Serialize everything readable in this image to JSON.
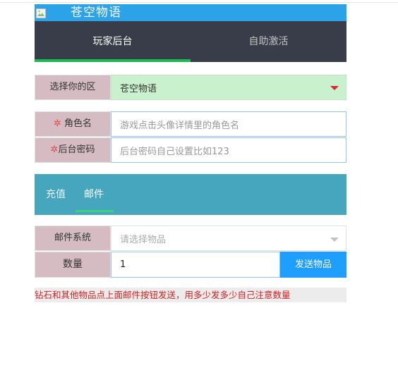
{
  "header": {
    "title": "苍空物语"
  },
  "tabs": [
    {
      "label": "玩家后台",
      "active": true
    },
    {
      "label": "自助激活",
      "active": false
    }
  ],
  "zone": {
    "label": "选择你的区",
    "value": "苍空物语"
  },
  "role": {
    "label": "角色名",
    "placeholder": "游戏点击头像详情里的角色名"
  },
  "password": {
    "label": "后台密码",
    "placeholder": "后台密码自己设置比如123"
  },
  "panel_tabs": [
    {
      "label": "充值",
      "active": false
    },
    {
      "label": "邮件",
      "active": true
    }
  ],
  "mail": {
    "label": "邮件系统",
    "placeholder": "请选择物品"
  },
  "quantity": {
    "label": "数量",
    "value": "1"
  },
  "send_button": "发送物品",
  "note": "钻石和其他物品点上面邮件按钮发送，用多少发多少自己注意数量",
  "colors": {
    "header": "#2aa3e8",
    "tab_bg": "#393d49",
    "accent_green": "#1cb954",
    "panel": "#46a6be",
    "label_bg": "#d4bcc2",
    "button": "#1e9fff",
    "note_text": "#d62020"
  }
}
